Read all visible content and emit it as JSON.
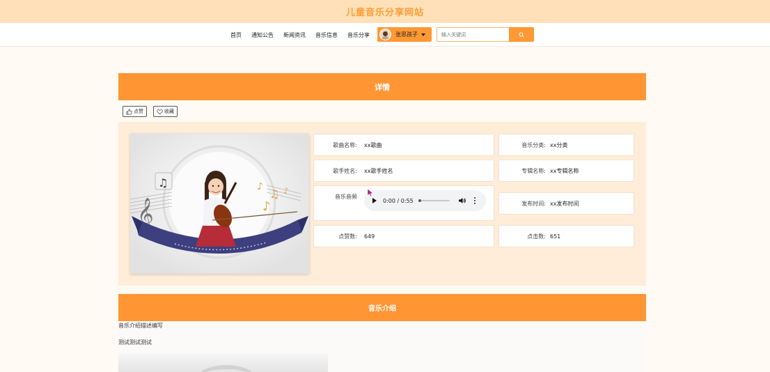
{
  "site": {
    "title": "儿童音乐分享网站"
  },
  "nav": {
    "items": [
      "首页",
      "通知公告",
      "新闻资讯",
      "音乐信息",
      "音乐分享"
    ],
    "user_name": "张思孩子",
    "search_placeholder": "输入关键词"
  },
  "detail": {
    "header": "详情",
    "like_button": "点赞",
    "favorite_button": "收藏",
    "fields": {
      "song_name": {
        "label": "歌曲名称:",
        "value": "xx歌曲"
      },
      "category": {
        "label": "音乐分类:",
        "value": "xx分类"
      },
      "singer": {
        "label": "歌手姓名:",
        "value": "xx歌手姓名"
      },
      "album": {
        "label": "专辑名称:",
        "value": "xx专辑名称"
      },
      "audio": {
        "label": "音乐音频"
      },
      "release_time": {
        "label": "发布时间:",
        "value": "xx发布时间"
      },
      "likes": {
        "label": "点赞数:",
        "value": "649"
      },
      "clicks": {
        "label": "点击数:",
        "value": "651"
      }
    },
    "audio_player": {
      "time": "0:00 / 0:55",
      "progress": 0
    }
  },
  "intro": {
    "header": "音乐介绍",
    "lines": [
      "音乐介绍描述编写",
      "测试测试测试"
    ]
  },
  "colors": {
    "accent": "#ff9533",
    "header_bg": "#ffe0b8",
    "panel_bg": "#ffedd9",
    "page_bg": "#fffaf3"
  }
}
